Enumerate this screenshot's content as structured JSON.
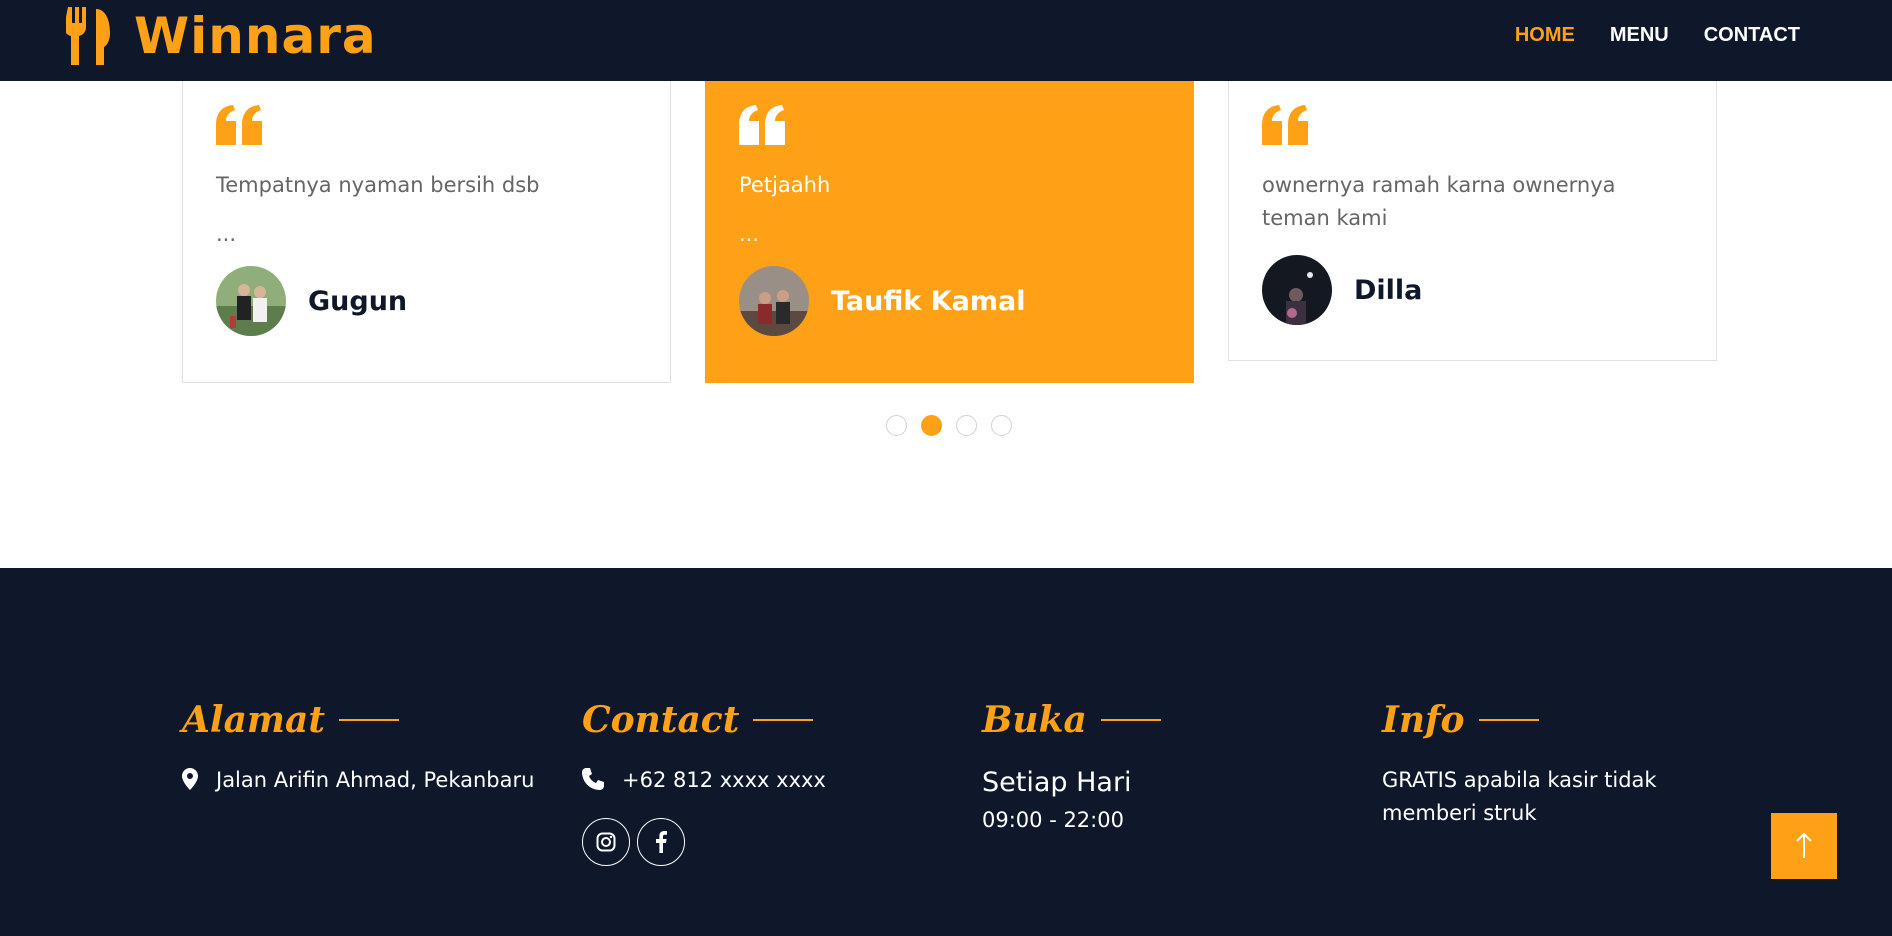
{
  "brand": {
    "name": "Winnara",
    "icon": "utensils-icon"
  },
  "nav": {
    "home": "HOME",
    "menu": "MENU",
    "contact": "CONTACT"
  },
  "testimonials": [
    {
      "review": "Tempatnya nyaman bersih dsb",
      "ellipsis": "...",
      "name": "Gugun"
    },
    {
      "review": "Petjaahh",
      "ellipsis": "...",
      "name": "Taufik Kamal"
    },
    {
      "review": "ownernya ramah karna ownernya teman kami",
      "name": "Dilla"
    }
  ],
  "carousel": {
    "active_index": 2,
    "total": 4
  },
  "footer": {
    "alamat": {
      "title": "Alamat",
      "address": "Jalan Arifin Ahmad, Pekanbaru"
    },
    "contact": {
      "title": "Contact",
      "phone": "+62 812 xxxx xxxx",
      "social": [
        "instagram-icon",
        "facebook-icon"
      ]
    },
    "buka": {
      "title": "Buka",
      "day": "Setiap Hari",
      "time": "09:00 - 22:00"
    },
    "info": {
      "title": "Info",
      "text": "GRATIS apabila kasir tidak memberi struk"
    }
  },
  "colors": {
    "accent": "#fea116",
    "dark": "#0f172b",
    "text_muted": "#666565"
  }
}
